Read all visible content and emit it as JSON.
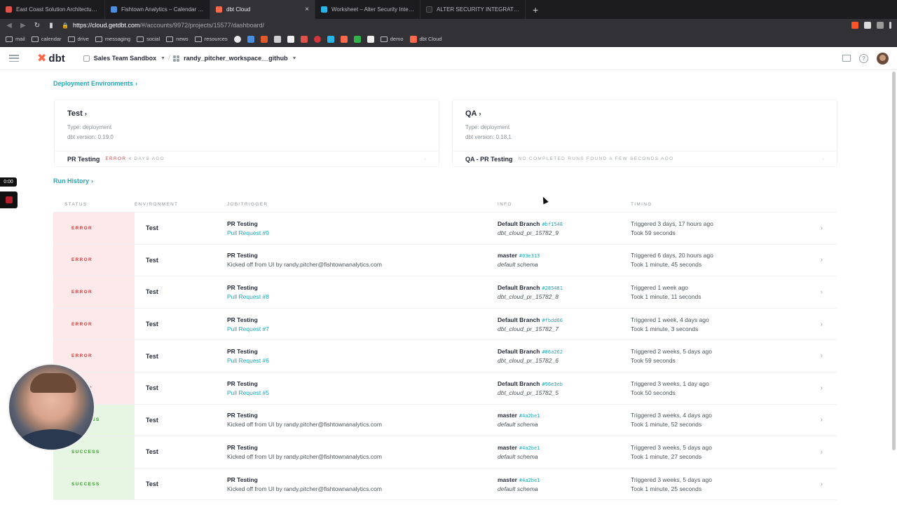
{
  "browser": {
    "tabs": [
      {
        "title": "East Coast Solution Architecture – All",
        "color": "#e0524a",
        "active": false
      },
      {
        "title": "Fishtown Analytics – Calendar – Week",
        "color": "#4a8fe0",
        "active": false
      },
      {
        "title": "dbt Cloud",
        "color": "#ff694a",
        "active": true
      },
      {
        "title": "Worksheet – Alter Security Integration",
        "color": "#29b5e8",
        "active": false
      },
      {
        "title": "ALTER SECURITY INTEGRATION — …",
        "color": "#2a2a2e",
        "active": false
      }
    ],
    "new_tab_label": "+",
    "close_label": "×",
    "url_host": "https://cloud.getdbt.com",
    "url_path": "/#/accounts/9972/projects/15577/dashboard/",
    "bookmarks": [
      "mail",
      "calendar",
      "drive",
      "messaging",
      "social",
      "news",
      "resources",
      "demo",
      "dbt Cloud"
    ]
  },
  "app": {
    "logo_text": "dbt",
    "account": "Sales Team Sandbox",
    "project": "randy_pitcher_workspace__github",
    "separator": "/"
  },
  "sections": {
    "deployment_environments": "Deployment Environments",
    "run_history": "Run History"
  },
  "environments": [
    {
      "name": "Test",
      "type_line": "Type: deployment",
      "version_line": "dbt version: 0.19.0",
      "last_job": "PR Testing",
      "status_label": "ERROR",
      "status_time": "4 DAYS AGO"
    },
    {
      "name": "QA",
      "type_line": "Type: deployment",
      "version_line": "dbt version: 0.18.1",
      "last_job": "QA - PR Testing",
      "status_label": "NO COMPLETED RUNS FOUND",
      "status_time": "A FEW SECONDS AGO"
    }
  ],
  "table": {
    "headers": [
      "STATUS",
      "ENVIRONMENT",
      "JOB/TRIGGER",
      "INFO",
      "TIMING"
    ],
    "rows": [
      {
        "status": "ERROR",
        "env": "Test",
        "job": "PR Testing",
        "trigger": "Pull Request #9",
        "branch": "Default Branch",
        "sha": "#bf1548",
        "schema": "dbt_cloud_pr_15782_9",
        "triggered": "Triggered 3 days, 17 hours ago",
        "took": "Took 59 seconds"
      },
      {
        "status": "ERROR",
        "env": "Test",
        "job": "PR Testing",
        "trigger": "Kicked off from UI by randy.pitcher@fishtownanalytics.com",
        "branch": "master",
        "sha": "#03e313",
        "schema": "default schema",
        "triggered": "Triggered 6 days, 20 hours ago",
        "took": "Took 1 minute, 45 seconds"
      },
      {
        "status": "ERROR",
        "env": "Test",
        "job": "PR Testing",
        "trigger": "Pull Request #8",
        "branch": "Default Branch",
        "sha": "#285481",
        "schema": "dbt_cloud_pr_15782_8",
        "triggered": "Triggered 1 week ago",
        "took": "Took 1 minute, 11 seconds"
      },
      {
        "status": "ERROR",
        "env": "Test",
        "job": "PR Testing",
        "trigger": "Pull Request #7",
        "branch": "Default Branch",
        "sha": "#fbdd66",
        "schema": "dbt_cloud_pr_15782_7",
        "triggered": "Triggered 1 week, 4 days ago",
        "took": "Took 1 minute, 3 seconds"
      },
      {
        "status": "ERROR",
        "env": "Test",
        "job": "PR Testing",
        "trigger": "Pull Request #6",
        "branch": "Default Branch",
        "sha": "#86a262",
        "schema": "dbt_cloud_pr_15782_6",
        "triggered": "Triggered 2 weeks, 5 days ago",
        "took": "Took 59 seconds"
      },
      {
        "status": "ERROR",
        "env": "Test",
        "job": "PR Testing",
        "trigger": "Pull Request #5",
        "branch": "Default Branch",
        "sha": "#96e3eb",
        "schema": "dbt_cloud_pr_15782_5",
        "triggered": "Triggered 3 weeks, 1 day ago",
        "took": "Took 50 seconds"
      },
      {
        "status": "SUCCESS",
        "env": "Test",
        "job": "PR Testing",
        "trigger": "Kicked off from UI by randy.pitcher@fishtownanalytics.com",
        "branch": "master",
        "sha": "#4a2be1",
        "schema": "default schema",
        "triggered": "Triggered 3 weeks, 4 days ago",
        "took": "Took 1 minute, 52 seconds"
      },
      {
        "status": "SUCCESS",
        "env": "Test",
        "job": "PR Testing",
        "trigger": "Kicked off from UI by randy.pitcher@fishtownanalytics.com",
        "branch": "master",
        "sha": "#4a2be1",
        "schema": "default schema",
        "triggered": "Triggered 3 weeks, 5 days ago",
        "took": "Took 1 minute, 27 seconds"
      },
      {
        "status": "SUCCESS",
        "env": "Test",
        "job": "PR Testing",
        "trigger": "Kicked off from UI by randy.pitcher@fishtownanalytics.com",
        "branch": "master",
        "sha": "#4a2be1",
        "schema": "default schema",
        "triggered": "Triggered 3 weeks, 5 days ago",
        "took": "Took 1 minute, 25 seconds"
      }
    ]
  },
  "recorder": {
    "timer": "0:00"
  },
  "colors": {
    "accent": "#1fa9b5",
    "error": "#d93c3c",
    "success": "#3aa02e",
    "brand": "#ff694a"
  }
}
